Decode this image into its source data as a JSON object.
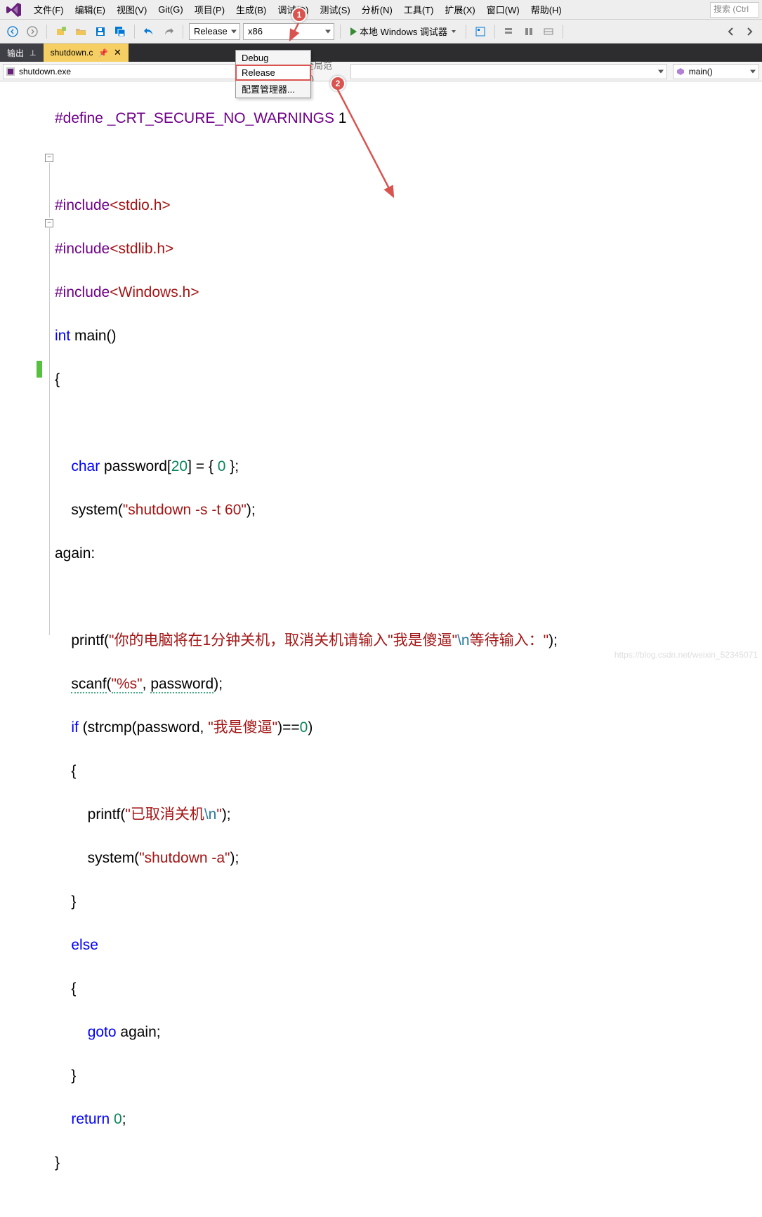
{
  "menu": {
    "file": "文件(F)",
    "edit": "编辑(E)",
    "view": "视图(V)",
    "git": "Git(G)",
    "project": "项目(P)",
    "build": "生成(B)",
    "debug": "调试(D)",
    "test": "测试(S)",
    "analyze": "分析(N)",
    "tools": "工具(T)",
    "extensions": "扩展(X)",
    "window": "窗口(W)",
    "help": "帮助(H)"
  },
  "search_placeholder": "搜索 (Ctrl",
  "toolbar": {
    "config": "Release",
    "platform": "x86",
    "run": "本地 Windows 调试器"
  },
  "dropdown": {
    "debug": "Debug",
    "release": "Release",
    "config_mgr": "配置管理器..."
  },
  "tabs": {
    "output": "输出",
    "file": "shutdown.c"
  },
  "ctx": {
    "exe": "shutdown.exe",
    "scope": "(全局范围)",
    "main": "main()"
  },
  "code": {
    "l1a": "#define ",
    "l1b": "_CRT_SECURE_NO_WARNINGS",
    "l1c": " 1",
    "l3a": "#include",
    "l3b": "<stdio.h>",
    "l4a": "#include",
    "l4b": "<stdlib.h>",
    "l5a": "#include",
    "l5b": "<Windows.h>",
    "l6a": "int",
    "l6b": " main()",
    "l7": "{",
    "l9a": "    ",
    "l9b": "char",
    "l9c": " password[",
    "l9d": "20",
    "l9e": "] = { ",
    "l9f": "0",
    "l9g": " };",
    "l10a": "    system(",
    "l10b": "\"shutdown -s -t 60\"",
    "l10c": ");",
    "l11": "again:",
    "l13a": "    printf(",
    "l13b": "\"你的电脑将在1分钟关机，取消关机请输入\"我是傻逼\"",
    "l13c": "\\n",
    "l13d": "等待输入：\"",
    "l13e": ");",
    "l14a": "    ",
    "l14b": "scanf",
    "l14c": "(",
    "l14d": "\"%s\"",
    "l14e": ", ",
    "l14f": "password",
    "l14g": ");",
    "l15a": "    ",
    "l15b": "if",
    "l15c": " (strcmp(password, ",
    "l15d": "\"我是傻逼\"",
    "l15e": ")==",
    "l15f": "0",
    "l15g": ")",
    "l16": "    {",
    "l17a": "        printf(",
    "l17b": "\"已取消关机",
    "l17c": "\\n",
    "l17d": "\"",
    "l17e": ");",
    "l18a": "        system(",
    "l18b": "\"shutdown -a\"",
    "l18c": ");",
    "l19": "    }",
    "l20a": "    ",
    "l20b": "else",
    "l21": "    {",
    "l22a": "        ",
    "l22b": "goto",
    "l22c": " again;",
    "l23": "    }",
    "l24a": "    ",
    "l24b": "return",
    "l24c": " ",
    "l24d": "0",
    "l24e": ";",
    "l25": "}"
  },
  "markers": {
    "one": "1",
    "two": "2"
  },
  "watermark": "https://blog.csdn.net/weixin_52345071"
}
